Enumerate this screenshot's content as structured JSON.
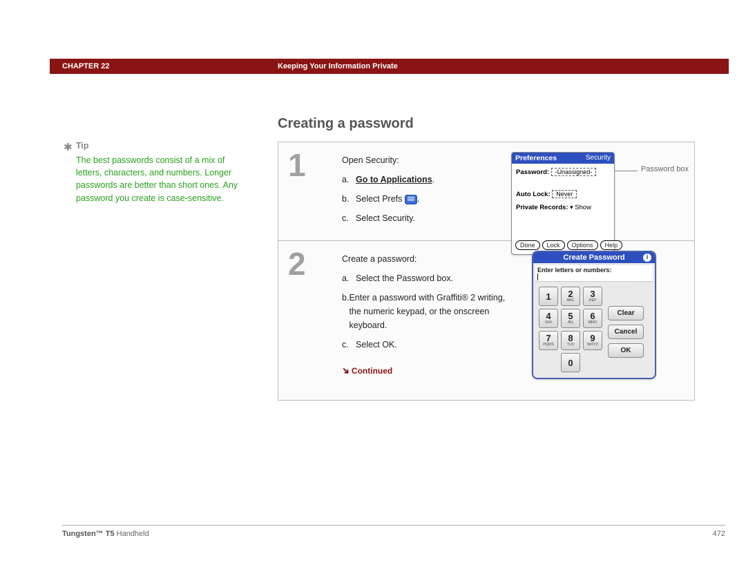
{
  "header": {
    "chapter": "CHAPTER 22",
    "title": "Keeping Your Information Private"
  },
  "page_title": "Creating a password",
  "tip": {
    "label": "Tip",
    "body": "The best passwords consist of a mix of letters, characters, and numbers. Longer passwords are better than short ones. Any password you create is case-sensitive."
  },
  "step1": {
    "num": "1",
    "intro": "Open Security:",
    "a_label": "a.",
    "a_text": "Go to Applications",
    "a_suffix": ".",
    "b_label": "b.",
    "b_text": "Select Prefs",
    "b_suffix": ".",
    "c_label": "c.",
    "c_text": "Select Security.",
    "palm": {
      "left": "Preferences",
      "right": "Security",
      "password_lbl": "Password:",
      "password_val": "-Unassigned-",
      "autolock_lbl": "Auto Lock:",
      "autolock_val": "Never",
      "private_lbl": "Private Records:",
      "private_val": "Show",
      "btn_done": "Done",
      "btn_lock": "Lock",
      "btn_options": "Options",
      "btn_help": "Help"
    },
    "callout": "Password box"
  },
  "step2": {
    "num": "2",
    "intro": "Create a password:",
    "a_label": "a.",
    "a_text": "Select the Password box.",
    "b_label": "b.",
    "b_text": "Enter a password with Graffiti® 2 writing, the numeric keypad, or the onscreen keyboard.",
    "c_label": "c.",
    "c_text": "Select OK.",
    "continued": "Continued",
    "dialog": {
      "title": "Create Password",
      "prompt": "Enter letters or numbers:",
      "keys": {
        "1": "1",
        "2": "2",
        "2s": "ABC",
        "3": "3",
        "3s": "DEF",
        "4": "4",
        "4s": "GHI",
        "5": "5",
        "5s": "JKL",
        "6": "6",
        "6s": "MNO",
        "7": "7",
        "7s": "PQRS",
        "8": "8",
        "8s": "TUV",
        "9": "9",
        "9s": "WXYZ",
        "0": "0"
      },
      "clear": "Clear",
      "cancel": "Cancel",
      "ok": "OK"
    }
  },
  "footer": {
    "product_bold": "Tungsten™ T5",
    "product_rest": " Handheld",
    "page": "472"
  }
}
